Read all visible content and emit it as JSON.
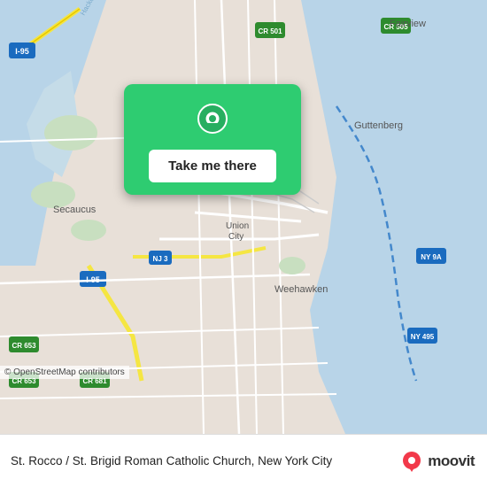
{
  "map": {
    "credit": "© OpenStreetMap contributors",
    "background_color": "#e8e0d8"
  },
  "card": {
    "button_label": "Take me there"
  },
  "footer": {
    "location_name": "St. Rocco / St. Brigid Roman Catholic Church, New York City",
    "logo_text": "moovit"
  }
}
